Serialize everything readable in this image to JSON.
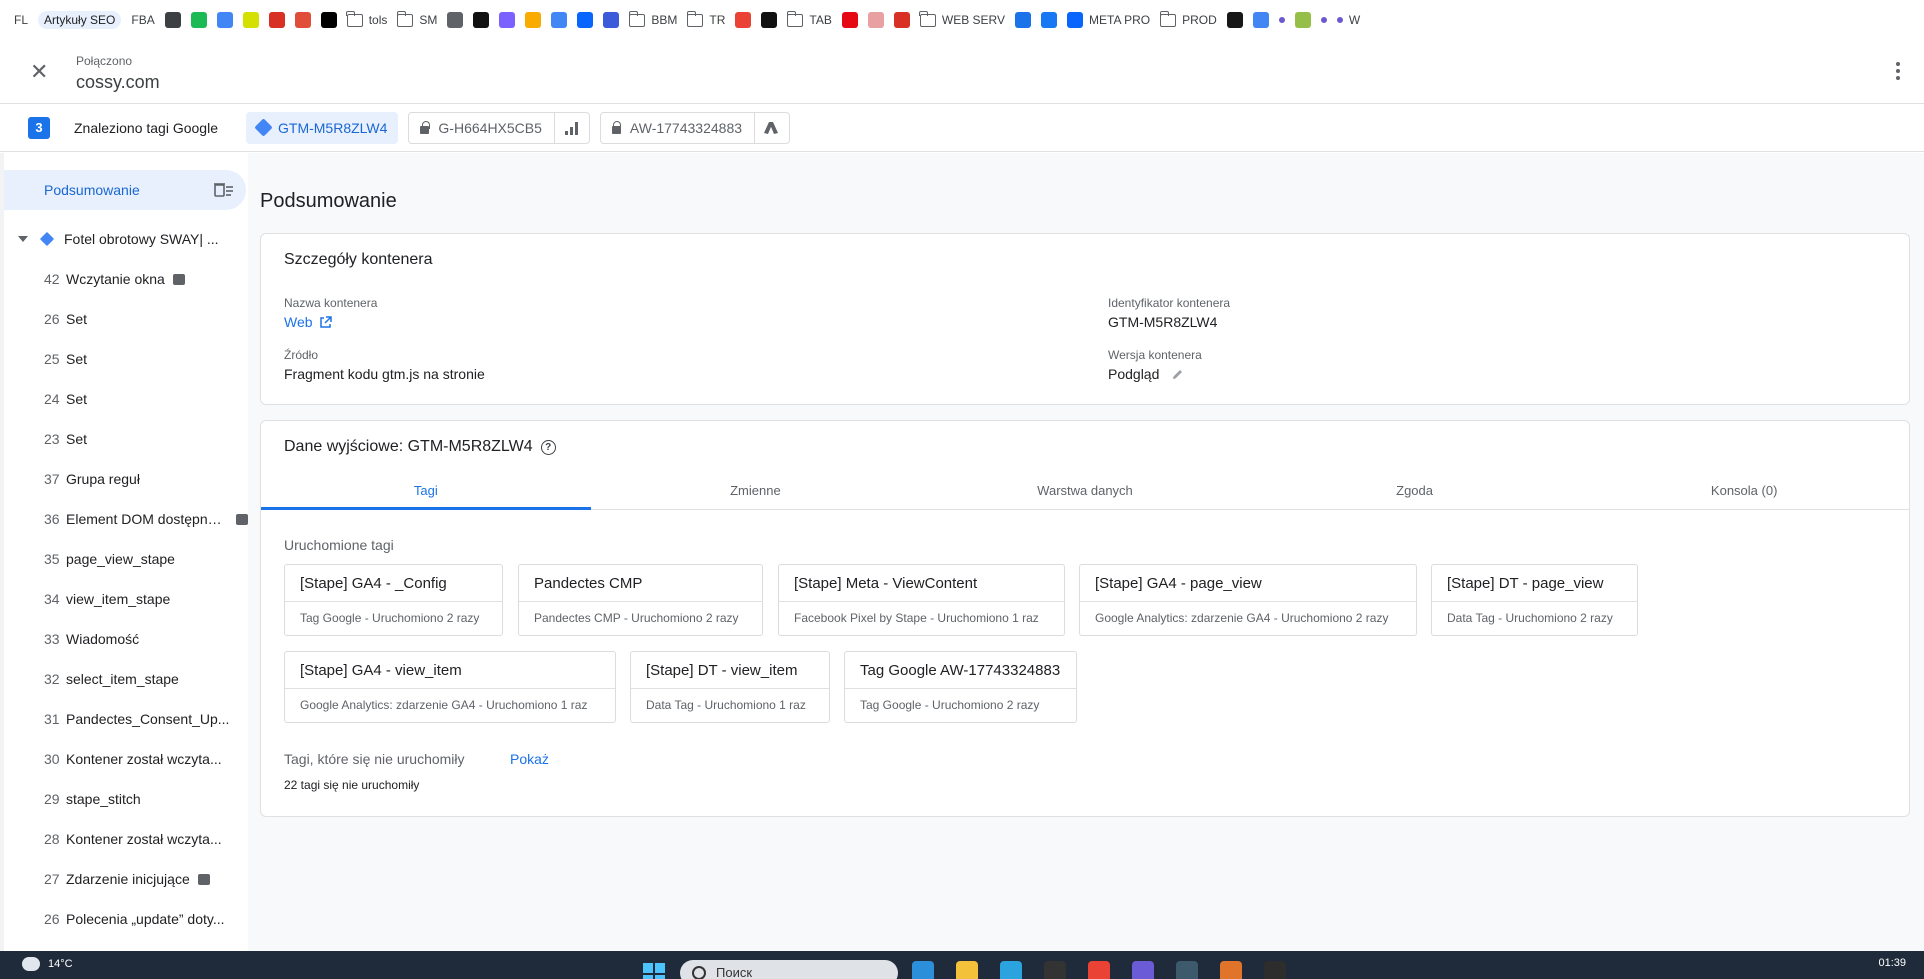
{
  "bookmarks": [
    {
      "kind": "text",
      "label": "FL"
    },
    {
      "kind": "pill",
      "label": "Artykuły SEO"
    },
    {
      "kind": "text",
      "label": "FBA"
    },
    {
      "kind": "icon",
      "icon": "apps-grid-icon",
      "color": "#3c4043"
    },
    {
      "kind": "icon",
      "icon": "spotify-icon",
      "color": "#1db954"
    },
    {
      "kind": "icon",
      "icon": "docs-icon",
      "color": "#4285f4"
    },
    {
      "kind": "icon",
      "icon": "lightning-icon",
      "color": "#d4e000"
    },
    {
      "kind": "icon",
      "icon": "ahrefs-icon",
      "color": "#d93025"
    },
    {
      "kind": "icon",
      "icon": "pinwheel-icon",
      "color": "#e04e39"
    },
    {
      "kind": "icon",
      "icon": "threads-icon",
      "color": "#000000"
    },
    {
      "kind": "folder",
      "label": "tols"
    },
    {
      "kind": "folder",
      "label": "SM"
    },
    {
      "kind": "icon",
      "icon": "openai-icon",
      "color": "#5f6368"
    },
    {
      "kind": "icon",
      "icon": "instagram-icon",
      "color": "#111111"
    },
    {
      "kind": "icon",
      "icon": "circle-c-icon",
      "color": "#7b61ff"
    },
    {
      "kind": "icon",
      "icon": "analytics-icon",
      "color": "#f9ab00"
    },
    {
      "kind": "icon",
      "icon": "google-icon",
      "color": "#4285f4"
    },
    {
      "kind": "icon",
      "icon": "meta-icon",
      "color": "#0866ff"
    },
    {
      "kind": "icon",
      "icon": "booking-icon",
      "color": "#3b5bdb"
    },
    {
      "kind": "folder",
      "label": "BBM"
    },
    {
      "kind": "folder",
      "label": "TR"
    },
    {
      "kind": "icon",
      "icon": "gmail-icon",
      "color": "#ea4335"
    },
    {
      "kind": "icon",
      "icon": "fb-box-icon",
      "color": "#111111"
    },
    {
      "kind": "folder",
      "label": "TAB"
    },
    {
      "kind": "icon",
      "icon": "netflix-icon",
      "color": "#e50914"
    },
    {
      "kind": "icon",
      "icon": "printer-icon",
      "color": "#e8a0a0"
    },
    {
      "kind": "icon",
      "icon": "e-icon",
      "color": "#d93025"
    },
    {
      "kind": "folder",
      "label": "WEB SERV"
    },
    {
      "kind": "icon",
      "icon": "controller-icon",
      "color": "#1a73e8"
    },
    {
      "kind": "icon",
      "icon": "facebook-icon",
      "color": "#1877f2"
    },
    {
      "kind": "meta",
      "label": "META PRO",
      "icon": "meta-icon",
      "color": "#0866ff"
    },
    {
      "kind": "folder",
      "label": "PROD"
    },
    {
      "kind": "icon",
      "icon": "github-icon",
      "color": "#181717"
    },
    {
      "kind": "icon",
      "icon": "translate-icon",
      "color": "#4285f4"
    },
    {
      "kind": "icon",
      "icon": "dot-icon",
      "color": "#6a5acd"
    },
    {
      "kind": "icon",
      "icon": "shopify-icon",
      "color": "#95bf47"
    },
    {
      "kind": "icon",
      "icon": "dot-icon",
      "color": "#6a5acd"
    },
    {
      "kind": "icon",
      "icon": "dot-icon",
      "color": "#6a5acd",
      "label": "W"
    }
  ],
  "header": {
    "status": "Połączono",
    "domain": "cossy.com"
  },
  "tagstrip": {
    "count": "3",
    "label": "Znaleziono tagi Google",
    "chips": [
      {
        "id": "GTM-M5R8ZLW4",
        "icon": "gtm-diamond-icon",
        "active": true
      },
      {
        "id": "G-H664HX5CB5",
        "icon": "lock-icon",
        "trailing_icon": "analytics-bars-icon"
      },
      {
        "id": "AW-17743324883",
        "icon": "lock-icon",
        "trailing_icon": "google-ads-icon"
      }
    ]
  },
  "sidebar": {
    "summary": "Podsumowanie",
    "page": "Fotel obrotowy SWAY| ...",
    "events": [
      {
        "num": "42",
        "name": "Wczytanie okna",
        "code": true
      },
      {
        "num": "26",
        "name": "Set"
      },
      {
        "num": "25",
        "name": "Set"
      },
      {
        "num": "24",
        "name": "Set"
      },
      {
        "num": "23",
        "name": "Set"
      },
      {
        "num": "37",
        "name": "Grupa reguł"
      },
      {
        "num": "36",
        "name": "Element DOM dostępny ...",
        "code": true
      },
      {
        "num": "35",
        "name": "page_view_stape"
      },
      {
        "num": "34",
        "name": "view_item_stape"
      },
      {
        "num": "33",
        "name": "Wiadomość"
      },
      {
        "num": "32",
        "name": "select_item_stape"
      },
      {
        "num": "31",
        "name": "Pandectes_Consent_Up..."
      },
      {
        "num": "30",
        "name": "Kontener został wczyta..."
      },
      {
        "num": "29",
        "name": "stape_stitch"
      },
      {
        "num": "28",
        "name": "Kontener został wczyta..."
      },
      {
        "num": "27",
        "name": "Zdarzenie inicjujące",
        "code": true
      },
      {
        "num": "26",
        "name": "Polecenia „update” doty..."
      }
    ]
  },
  "main": {
    "title": "Podsumowanie",
    "details": {
      "title": "Szczegóły kontenera",
      "name_label": "Nazwa kontenera",
      "name_value": "Web",
      "id_label": "Identyfikator kontenera",
      "id_value": "GTM-M5R8ZLW4",
      "source_label": "Źródło",
      "source_value": "Fragment kodu gtm.js na stronie",
      "version_label": "Wersja kontenera",
      "version_value": "Podgląd"
    },
    "output": {
      "title": "Dane wyjściowe: GTM-M5R8ZLW4",
      "help": "?",
      "tabs": [
        "Tagi",
        "Zmienne",
        "Warstwa danych",
        "Zgoda",
        "Konsola (0)"
      ],
      "fired_title": "Uruchomione tagi",
      "fired_tags": [
        {
          "name": "[Stape] GA4 - _Config",
          "desc": "Tag Google - Uruchomiono 2 razy"
        },
        {
          "name": "Pandectes CMP",
          "desc": "Pandectes CMP - Uruchomiono 2 razy"
        },
        {
          "name": "[Stape] Meta - ViewContent",
          "desc": "Facebook Pixel by Stape - Uruchomiono 1 raz"
        },
        {
          "name": "[Stape] GA4 - page_view",
          "desc": "Google Analytics: zdarzenie GA4 - Uruchomiono 2 razy"
        },
        {
          "name": "[Stape] DT - page_view",
          "desc": "Data Tag - Uruchomiono 2 razy"
        },
        {
          "name": "[Stape] GA4 - view_item",
          "desc": "Google Analytics: zdarzenie GA4 - Uruchomiono 1 raz"
        },
        {
          "name": "[Stape] DT - view_item",
          "desc": "Data Tag - Uruchomiono 1 raz"
        },
        {
          "name": "Tag Google AW-17743324883",
          "desc": "Tag Google - Uruchomiono 2 razy"
        }
      ],
      "not_fired_label": "Tagi, które się nie uruchomiły",
      "show_link": "Pokaż",
      "not_fired_count": "22 tagi się nie uruchomiły"
    }
  },
  "taskbar": {
    "temperature": "14°C",
    "search_placeholder": "Поиск",
    "time": "01:39",
    "apps": [
      {
        "icon": "vscode-icon",
        "color": "#2b8fd9"
      },
      {
        "icon": "explorer-icon",
        "color": "#f3c13a"
      },
      {
        "icon": "telegram-icon",
        "color": "#2aa3df"
      },
      {
        "icon": "ip-icon",
        "color": "#333333"
      },
      {
        "icon": "chrome-icon",
        "color": "#ea4335"
      },
      {
        "icon": "app-icon",
        "color": "#6b5bd6"
      },
      {
        "icon": "app-icon",
        "color": "#3d5a6c"
      },
      {
        "icon": "app-icon",
        "color": "#e0742a"
      },
      {
        "icon": "terminal-icon",
        "color": "#2d2d2d"
      }
    ]
  },
  "colors": {
    "accent": "#1a73e8",
    "active_bg": "#e8f0fe",
    "panel_bg": "#f8f9fa"
  }
}
